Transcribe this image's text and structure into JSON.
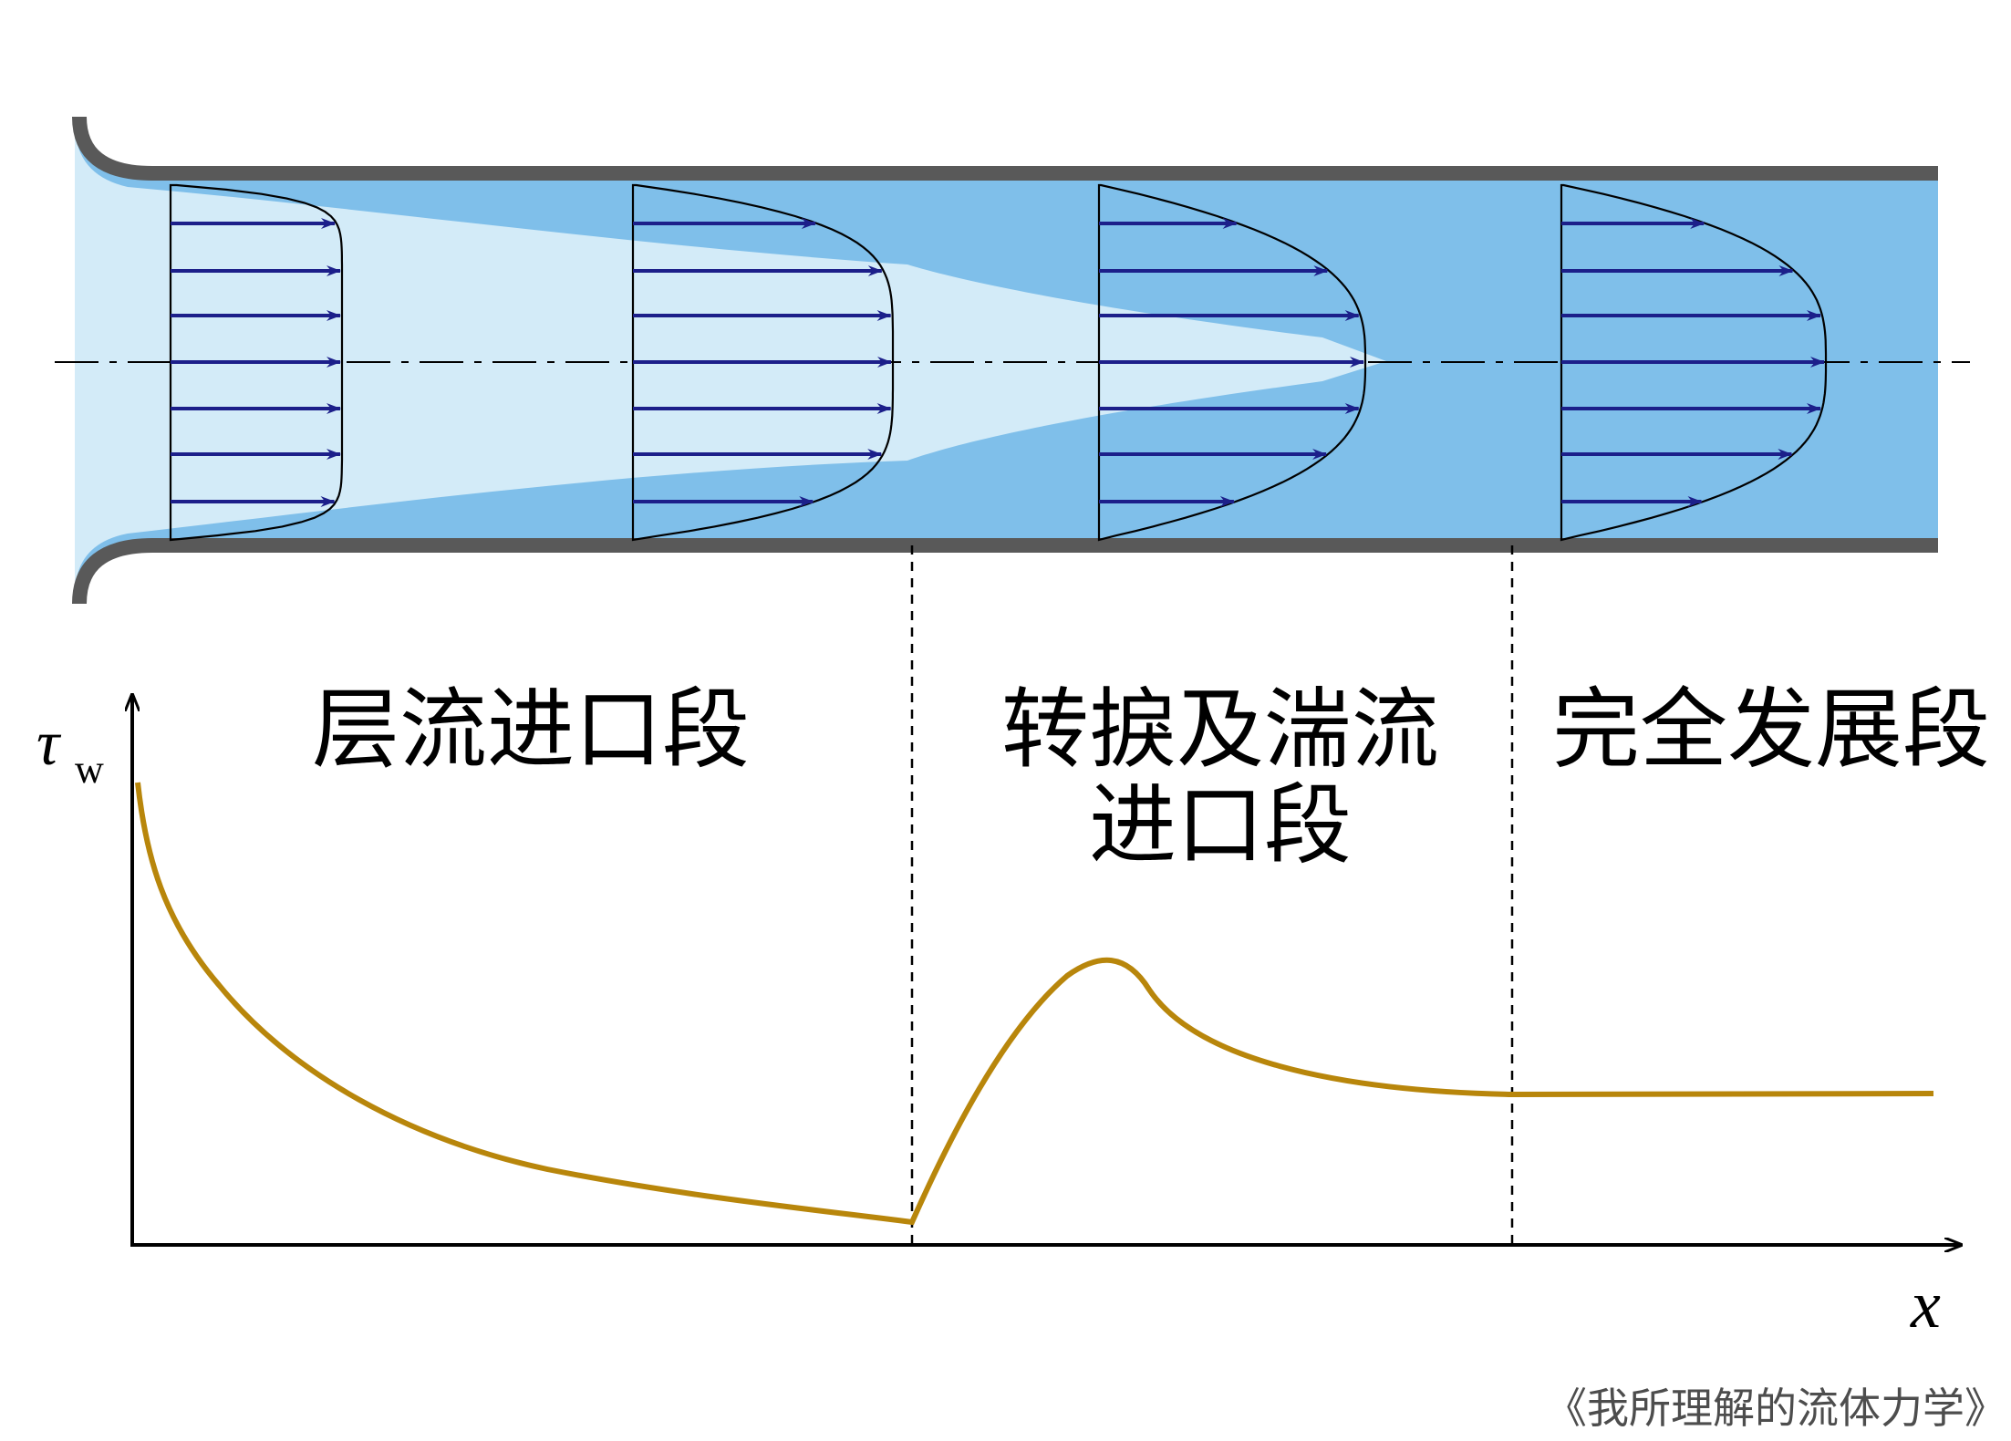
{
  "colors": {
    "wall": "#595959",
    "core": "#d3ebf8",
    "boundary_layer": "#7fbfea",
    "arrow": "#1c1f8a",
    "curve": "#b8860b"
  },
  "regions": {
    "laminar_entrance": "层流进口段",
    "transition_line1": "转捩及湍流",
    "transition_line2": "进口段",
    "fully_developed": "完全发展段"
  },
  "axes": {
    "y_symbol": "τ",
    "y_subscript": "w",
    "x_symbol": "x"
  },
  "credit": "《我所理解的流体力学》"
}
